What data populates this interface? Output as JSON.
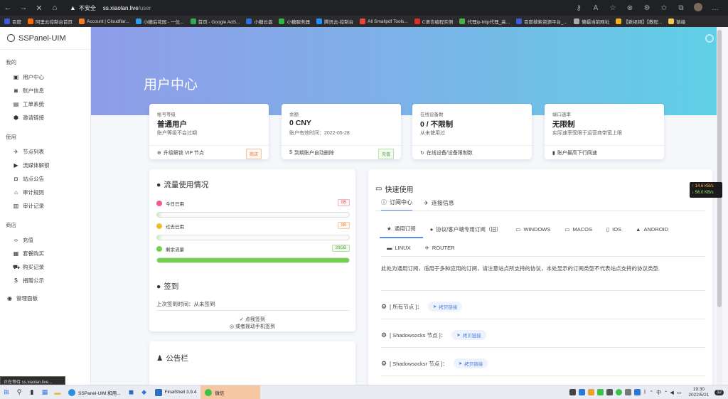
{
  "browser": {
    "insecure_label": "不安全",
    "url_host": "ss.xiaolan.live",
    "url_path": "/user"
  },
  "bookmarks": [
    {
      "label": "百度",
      "color": "#3b5bdb"
    },
    {
      "label": "阿里云控制台首页",
      "color": "#ff6a00"
    },
    {
      "label": "Account | Cloudflar...",
      "color": "#f38020"
    },
    {
      "label": "小糖后花园 - 一位...",
      "color": "#2f9ee8"
    },
    {
      "label": "首页 - Google AdS...",
      "color": "#34a853"
    },
    {
      "label": "小糖云盘",
      "color": "#2b6fe0"
    },
    {
      "label": "小糖服务器",
      "color": "#35b14a"
    },
    {
      "label": "腾讯云-控制台",
      "color": "#1e90ff"
    },
    {
      "label": "All Smallpdf Tools...",
      "color": "#e8453c"
    },
    {
      "label": "C语言编程实例",
      "color": "#d93025"
    },
    {
      "label": "代理ip-http代理_高...",
      "color": "#4caf50"
    },
    {
      "label": "百度搜索资源平台_...",
      "color": "#3b5bdb"
    },
    {
      "label": "懒蛆当前网址",
      "color": "#aaaaaa"
    },
    {
      "label": "【新视频】【教程...",
      "color": "#f2b01e"
    },
    {
      "label": "链接",
      "color": "#f2c94c"
    }
  ],
  "sidebar": {
    "brand": "SSPanel-UIM",
    "sections": [
      {
        "title": "我的",
        "items": [
          {
            "icon": "▣",
            "label": "用户中心",
            "name": "sidebar-item-user-center"
          },
          {
            "icon": "◙",
            "label": "账户信息",
            "name": "sidebar-item-account-info"
          },
          {
            "icon": "▤",
            "label": "工单系统",
            "name": "sidebar-item-tickets"
          },
          {
            "icon": "⬢",
            "label": "邀请链接",
            "name": "sidebar-item-invite"
          }
        ]
      },
      {
        "title": "使用",
        "items": [
          {
            "icon": "✈",
            "label": "节点列表",
            "name": "sidebar-item-nodes"
          },
          {
            "icon": "▶",
            "label": "流媒体解锁",
            "name": "sidebar-item-streaming"
          },
          {
            "icon": "◘",
            "label": "站点公告",
            "name": "sidebar-item-announcement"
          },
          {
            "icon": "⌂",
            "label": "审计规则",
            "name": "sidebar-item-audit-rules"
          },
          {
            "icon": "▥",
            "label": "审计记录",
            "name": "sidebar-item-audit-logs"
          }
        ]
      },
      {
        "title": "商店",
        "items": [
          {
            "icon": "‹›",
            "label": "充值",
            "name": "sidebar-item-recharge"
          },
          {
            "icon": "▦",
            "label": "套餐购买",
            "name": "sidebar-item-plans"
          },
          {
            "icon": "⛟",
            "label": "购买记录",
            "name": "sidebar-item-purchase-log"
          },
          {
            "icon": "$",
            "label": "捐赠公示",
            "name": "sidebar-item-donate"
          }
        ]
      }
    ],
    "admin": {
      "icon": "◉",
      "label": "管理面板"
    }
  },
  "hero": {
    "title": "用户中心"
  },
  "stats": [
    {
      "label": "帐号等级",
      "value": "普通用户",
      "sub": "账户等级不会过期",
      "foot_icon": "⊕",
      "foot": "升级解锁 VIP 节点",
      "badge": "商店",
      "badge_type": "warn"
    },
    {
      "label": "余额",
      "value": "0 CNY",
      "sub": "账户有效时间：2022-05-28",
      "foot_icon": "$",
      "foot": "到期账户自动删除",
      "badge": "充值",
      "badge_type": "ok"
    },
    {
      "label": "在线设备数",
      "value": "0 / 不限制",
      "sub": "从未使用过",
      "foot_icon": "↻",
      "foot": "在线设备/设备限制数",
      "badge": "",
      "badge_type": ""
    },
    {
      "label": "端口速率",
      "value": "无限制",
      "sub": "实际速率受限于运营商带宽上限",
      "foot_icon": "▮",
      "foot": "账户最高下行网速",
      "badge": "",
      "badge_type": ""
    }
  ],
  "traffic": {
    "title": "流量使用情况",
    "rows": [
      {
        "label": "今日已用",
        "value": "0B",
        "color": "#f25a8a",
        "type": "red",
        "fill": 0
      },
      {
        "label": "过去已用",
        "value": "0B",
        "color": "#e8c12c",
        "type": "orange",
        "fill": 0
      },
      {
        "label": "剩余流量",
        "value": "20GB",
        "color": "#6fd24a",
        "type": "green",
        "fill": 1
      }
    ]
  },
  "checkin": {
    "title": "签到",
    "last": "上次签到时间：从未签到",
    "click": "✓ 点我签到",
    "shake": "◎ 或者摇动手机签到"
  },
  "notice": {
    "title": "公告栏"
  },
  "quick": {
    "title": "快速使用",
    "tabs": [
      "订阅中心",
      "连接信息"
    ],
    "subtabs": [
      {
        "icon": "★",
        "label": "通用订阅"
      },
      {
        "icon": "●",
        "label": "协议/客户端专用订阅（旧）"
      },
      {
        "icon": "▭",
        "label": "WINDOWS"
      },
      {
        "icon": "▭",
        "label": "MACOS"
      },
      {
        "icon": "▯",
        "label": "IOS"
      },
      {
        "icon": "▲",
        "label": "ANDROID"
      },
      {
        "icon": "▬",
        "label": "LINUX"
      },
      {
        "icon": "✈",
        "label": "ROUTER"
      }
    ],
    "desc": "此处为通用订阅，适用于多种应用的订阅，请注意站点所支持的协议，本处显示的订阅类型不代表站点支持的协议类型.",
    "lines": [
      {
        "label": "[ 所有节点 ]：",
        "btn": "拷贝链接"
      },
      {
        "label": "[ Shadowsocks 节点 ]：",
        "btn": "拷贝链接"
      },
      {
        "label": "[ Shadowsocksr 节点 ]：",
        "btn": "拷贝链接"
      }
    ]
  },
  "net_speed": {
    "up": "↑ 14.6 KB/s",
    "down": "↓ 56.0 KB/s"
  },
  "status_tip": "正在等待 ss.xiaolan.live...",
  "taskbar": {
    "apps": [
      {
        "label": "SSPanel-UIM 和用...",
        "color": "#2b8fe0"
      },
      {
        "label": "FinalShell 3.9.4",
        "color": "#2f6fc0"
      },
      {
        "label": "微信",
        "color": "#3cc24a"
      }
    ],
    "time": "19:30",
    "date": "2022/5/21",
    "ime": "中",
    "notify": "12"
  }
}
